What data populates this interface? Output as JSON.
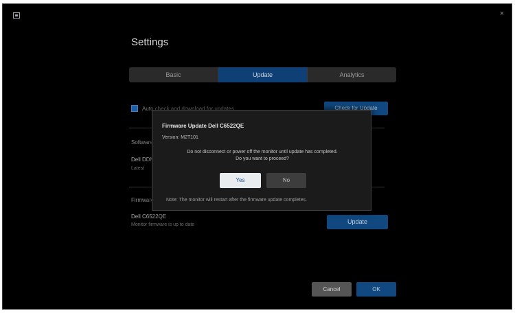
{
  "window": {
    "title": "Settings",
    "close_glyph": "×"
  },
  "tabs": [
    {
      "label": "Basic"
    },
    {
      "label": "Update"
    },
    {
      "label": "Analytics"
    }
  ],
  "update": {
    "auto_label": "Auto check and download for updates",
    "check_button": "Check for Update",
    "section_software": "Software",
    "software_name": "Dell DDM",
    "software_desc": "Latest",
    "section_firmware": "Firmware",
    "firmware_name": "Dell C6522QE",
    "firmware_desc": "Monitor firmware is up to date",
    "update_button": "Update"
  },
  "dialog": {
    "title": "Firmware Update Dell C6522QE",
    "version": "Version: M2T101",
    "message_line1": "Do not disconnect or power off the monitor until update has completed.",
    "message_line2": "Do you want to proceed?",
    "yes_label": "Yes",
    "no_label": "No",
    "note": "Note: The monitor will restart after the firmware update completes."
  },
  "footer": {
    "cancel_label": "Cancel",
    "ok_label": "OK"
  },
  "colors": {
    "accent": "#10487f",
    "active_tab": "#0e3f75",
    "background": "#000000",
    "dialog_bg": "#1b1b1b"
  },
  "icons": {
    "app": "app-window-icon",
    "close": "close-icon"
  }
}
